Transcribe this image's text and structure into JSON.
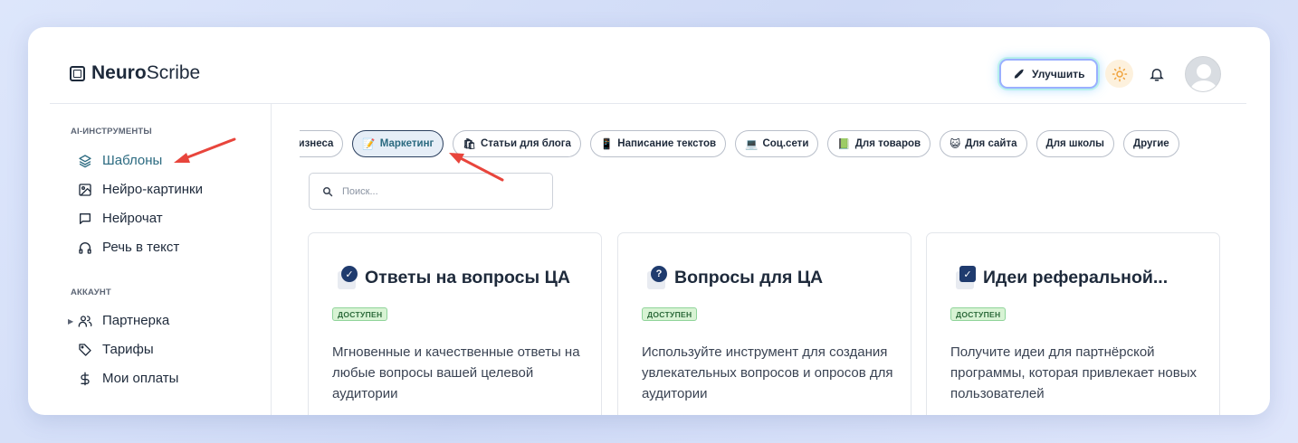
{
  "logo": {
    "brand_bold": "Neuro",
    "brand_rest": "Scribe"
  },
  "header": {
    "upgrade_label": "Улучшить"
  },
  "sidebar": {
    "section_tools": "AI-ИНСТРУМЕНТЫ",
    "tools": [
      {
        "label": "Шаблоны",
        "icon": "layers-icon",
        "active": true
      },
      {
        "label": "Нейро-картинки",
        "icon": "image-icon"
      },
      {
        "label": "Нейрочат",
        "icon": "chat-icon"
      },
      {
        "label": "Речь в текст",
        "icon": "headphones-icon"
      }
    ],
    "section_account": "АККАУНТ",
    "account": [
      {
        "label": "Партнерка",
        "icon": "users-icon"
      },
      {
        "label": "Тарифы",
        "icon": "tag-icon"
      },
      {
        "label": "Мои оплаты",
        "icon": "dollar-icon"
      }
    ]
  },
  "categories": [
    {
      "label": "Для бизнеса",
      "icon": ""
    },
    {
      "label": "Маркетинг",
      "icon": "📝",
      "active": true
    },
    {
      "label": "Статьи для блога",
      "icon": "🛍"
    },
    {
      "label": "Написание текстов",
      "icon": "📱"
    },
    {
      "label": "Соц.сети",
      "icon": "💻"
    },
    {
      "label": "Для товаров",
      "icon": "📗"
    },
    {
      "label": "Для сайта",
      "icon": "😺"
    },
    {
      "label": "Для школы",
      "icon": ""
    },
    {
      "label": "Другие",
      "icon": ""
    }
  ],
  "search": {
    "placeholder": "Поиск..."
  },
  "cards": [
    {
      "title": "Ответы на вопросы ЦА",
      "badge": "ДОСТУПЕН",
      "icon": "check-circle-icon",
      "description": "Мгновенные и качественные ответы на любые вопросы вашей целевой аудитории"
    },
    {
      "title": "Вопросы для ЦА",
      "badge": "ДОСТУПЕН",
      "icon": "question-circle-icon",
      "description": "Используйте инструмент для создания увлекательных вопросов и опросов для аудитории"
    },
    {
      "title": "Идеи реферальной...",
      "badge": "ДОСТУПЕН",
      "icon": "checkbox-icon",
      "description": "Получите идеи для партнёрской программы, которая привлекает новых пользователей"
    }
  ],
  "colors": {
    "accent": "#2b6a80",
    "annotation_arrow": "#e8453c",
    "badge_bg": "#d8f3d4"
  }
}
